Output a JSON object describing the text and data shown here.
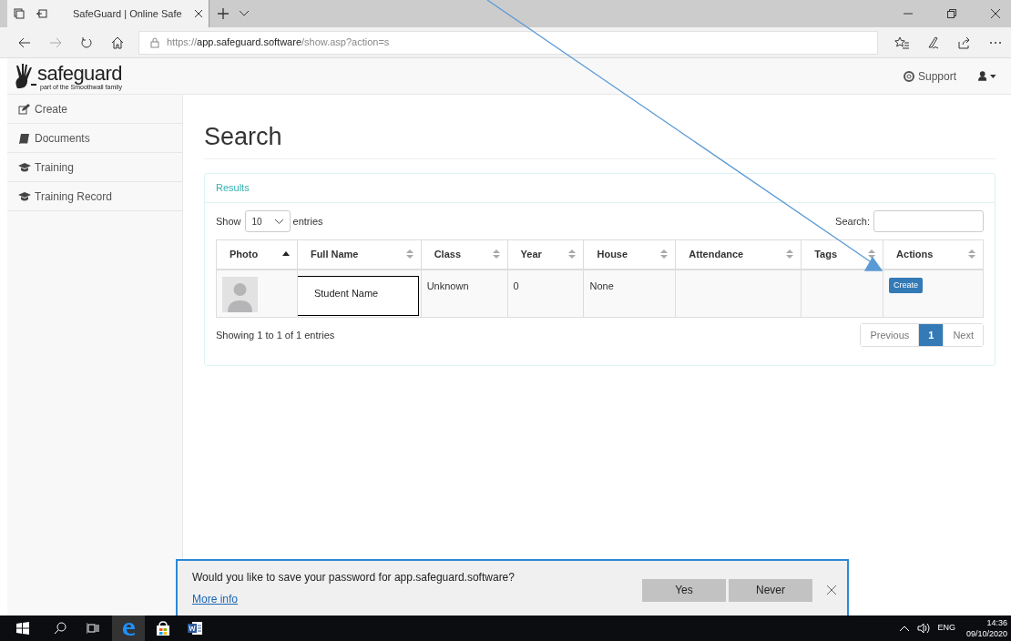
{
  "browser": {
    "tab_title": "SafeGuard | Online Safe",
    "address": {
      "scheme": "https://",
      "host": "app.safeguard.software",
      "path": "/show.asp?action=s"
    }
  },
  "header": {
    "logo": "safeguard",
    "tagline": "part of the Smoothwall family",
    "support": "Support"
  },
  "sidebar": {
    "items": [
      {
        "label": "Create"
      },
      {
        "label": "Documents"
      },
      {
        "label": "Training"
      },
      {
        "label": "Training Record"
      }
    ]
  },
  "page_title": "Search",
  "panel": {
    "title": "Results",
    "show_label": "Show",
    "page_size": "10",
    "entries_label": "entries",
    "search_label": "Search:",
    "table": {
      "columns": [
        {
          "label": "Photo",
          "sorted": true
        },
        {
          "label": "Full Name",
          "sorted": false
        },
        {
          "label": "Class",
          "sorted": false
        },
        {
          "label": "Year",
          "sorted": false
        },
        {
          "label": "House",
          "sorted": false
        },
        {
          "label": "Attendance",
          "sorted": false
        },
        {
          "label": "Tags",
          "sorted": false
        },
        {
          "label": "Actions",
          "sorted": false
        }
      ],
      "rows": [
        {
          "full_name": "Student Name",
          "class": "Unknown",
          "year": "0",
          "house": "None",
          "action": "Create"
        }
      ]
    },
    "info": "Showing 1 to 1 of 1 entries",
    "pagination": [
      {
        "label": "Previous",
        "selected": false
      },
      {
        "label": "1",
        "selected": true
      },
      {
        "label": "Next",
        "selected": false
      }
    ]
  },
  "password_prompt": {
    "message": "Would you like to save your password for app.safeguard.software?",
    "link": "More info",
    "buttons": [
      "Yes",
      "Never"
    ]
  },
  "taskbar": {
    "language": "ENG",
    "time": "14:36",
    "date": "09/10/2020"
  }
}
